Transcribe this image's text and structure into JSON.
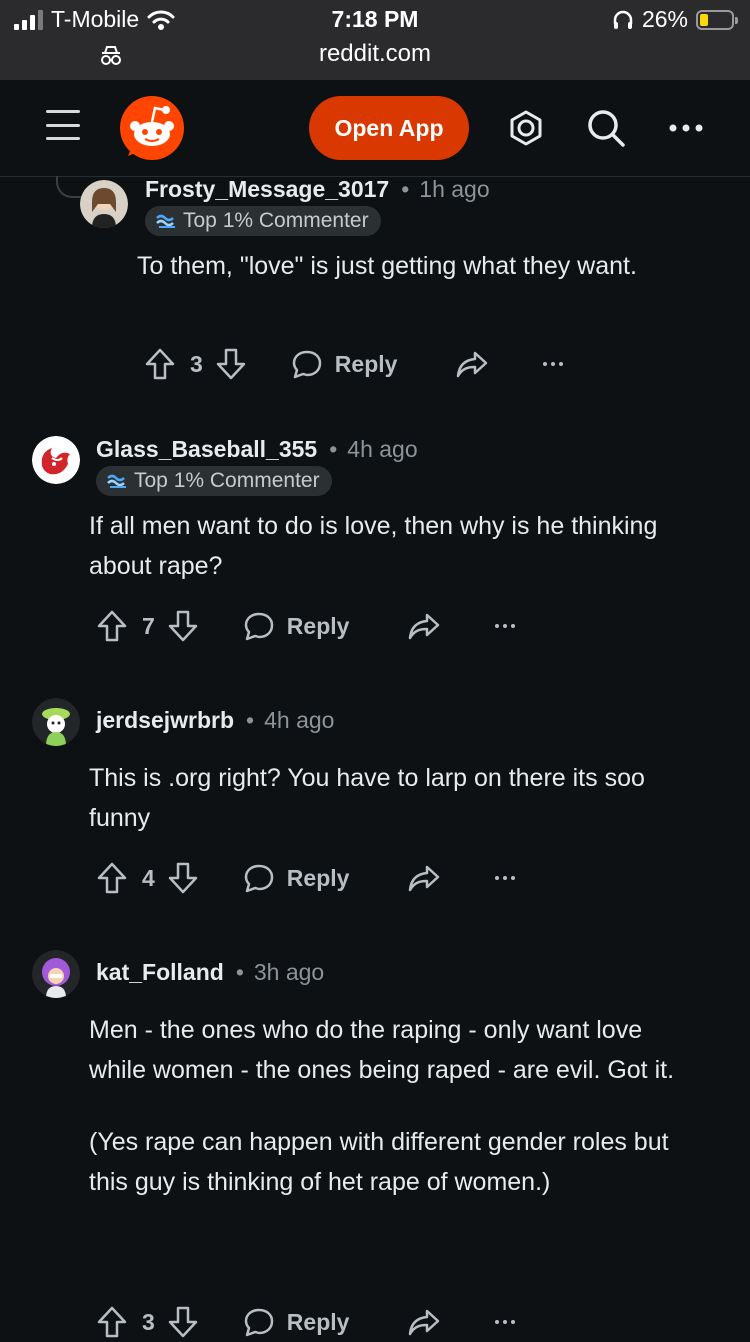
{
  "status_bar": {
    "carrier": "T-Mobile",
    "time": "7:18 PM",
    "url": "reddit.com",
    "battery_pct": "26%",
    "battery_level": 0.26
  },
  "header": {
    "open_app_label": "Open App",
    "icons": [
      "menu-icon",
      "reddit-logo",
      "ai-answers-icon",
      "search-icon",
      "more-icon"
    ]
  },
  "comments": [
    {
      "username": "Frosty_Message_3017",
      "time": "1h ago",
      "flair": "Top 1% Commenter",
      "body": [
        "To them, \"love\" is just getting what they want."
      ],
      "votes": "3",
      "reply_label": "Reply"
    },
    {
      "username": "Glass_Baseball_355",
      "time": "4h ago",
      "flair": "Top 1% Commenter",
      "body": [
        "If all men want to do is love, then why is he thinking about rape?"
      ],
      "votes": "7",
      "reply_label": "Reply"
    },
    {
      "username": "jerdsejwrbrb",
      "time": "4h ago",
      "flair": "",
      "body": [
        "This is .org right? You have to larp on there its soo funny"
      ],
      "votes": "4",
      "reply_label": "Reply"
    },
    {
      "username": "kat_Folland",
      "time": "3h ago",
      "flair": "",
      "body": [
        "Men - the ones who do the raping - only want love while women - the ones being raped - are evil. Got it.",
        "(Yes rape can happen with different gender roles but this guy is thinking of het rape of women.)"
      ],
      "votes": "3",
      "reply_label": "Reply"
    }
  ],
  "colors": {
    "background": "#0e1113",
    "status_bar": "#2b2b2d",
    "open_app": "#d93900",
    "text": "#e8eaed",
    "muted": "#8c9399"
  }
}
